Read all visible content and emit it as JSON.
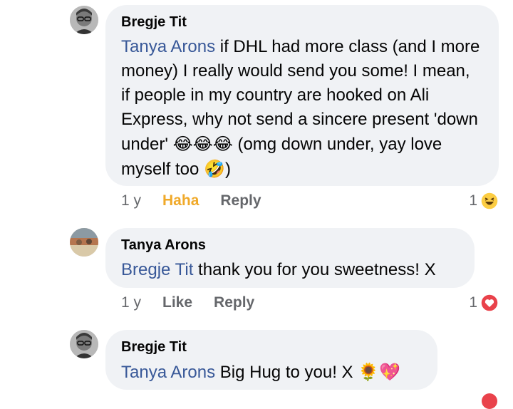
{
  "comments": [
    {
      "author": "Bregje Tit",
      "mention": "Tanya Arons",
      "text_part1": " if DHL had more class (and I more money) I really would send you some! I mean, if people in my country are hooked on Ali Express, why not send a sincere present 'down under' ",
      "emoji1": "😂😂😂",
      "text_part2": " (omg down under, yay love myself too ",
      "emoji2": "🤣",
      "text_part3": ")",
      "time": "1 y",
      "reaction_label": "Haha",
      "reply_label": "Reply",
      "reaction_count": "1",
      "reaction_icon": "haha-icon"
    },
    {
      "author": "Tanya Arons",
      "mention": "Bregje Tit",
      "text": " thank you for you sweetness! X",
      "time": "1 y",
      "like_label": "Like",
      "reply_label": "Reply",
      "reaction_count": "1",
      "reaction_icon": "love-icon"
    },
    {
      "author": "Bregje Tit",
      "mention": "Tanya Arons",
      "text": " Big Hug to you! X ",
      "emoji": "🌻💖"
    }
  ],
  "colors": {
    "mention": "#385898",
    "bubble": "#f0f2f5",
    "meta": "#65676b",
    "haha": "#f0a929",
    "love": "#e9424b"
  }
}
